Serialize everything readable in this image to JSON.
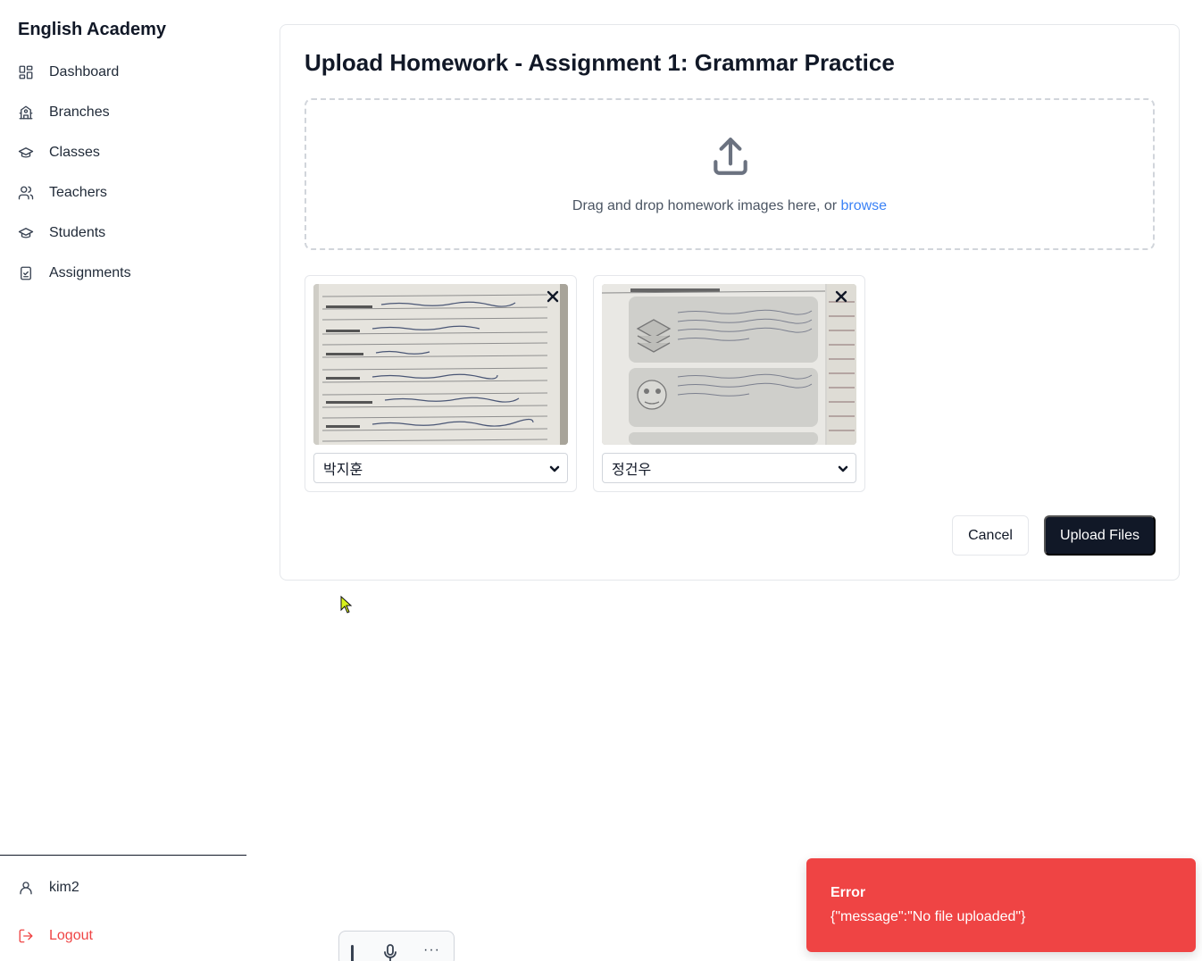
{
  "sidebar": {
    "brand": "English Academy",
    "items": [
      {
        "label": "Dashboard",
        "icon": "dashboard-icon"
      },
      {
        "label": "Branches",
        "icon": "building-icon"
      },
      {
        "label": "Classes",
        "icon": "graduation-cap-icon"
      },
      {
        "label": "Teachers",
        "icon": "users-icon"
      },
      {
        "label": "Students",
        "icon": "graduation-cap-icon"
      },
      {
        "label": "Assignments",
        "icon": "clipboard-check-icon"
      }
    ],
    "user": {
      "name": "kim2",
      "icon": "user-icon"
    },
    "logout": {
      "label": "Logout",
      "icon": "logout-icon",
      "color": "#ef4444"
    }
  },
  "upload": {
    "title": "Upload Homework - Assignment 1: Grammar Practice",
    "dropzone": {
      "text": "Drag and drop homework images here, or ",
      "link": "browse",
      "icon": "upload-icon"
    },
    "files": [
      {
        "student": "박지훈",
        "thumbnail": "handwritten-worksheet-photo"
      },
      {
        "student": "정건우",
        "thumbnail": "book-recommendation-worksheet-photo"
      }
    ],
    "cancel_label": "Cancel",
    "submit_label": "Upload Files",
    "accent": "#111827",
    "link_color": "#3b82f6"
  },
  "toolbar": {
    "icons": [
      "grip-icon",
      "microphone-icon",
      "more-icon"
    ],
    "more_label": "···"
  },
  "toast": {
    "title": "Error",
    "message": "{\"message\":\"No file uploaded\"}",
    "color": "#ef4444"
  }
}
